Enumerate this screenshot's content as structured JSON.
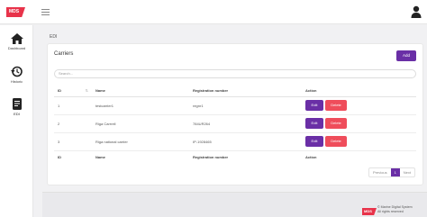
{
  "app": {
    "logo": "MDS",
    "breadcrumb": "EDI"
  },
  "sidebar": {
    "items": [
      {
        "label": "Dashboard",
        "icon": "home-icon"
      },
      {
        "label": "Historic",
        "icon": "history-icon"
      },
      {
        "label": "EDI",
        "icon": "document-icon"
      }
    ]
  },
  "card": {
    "title": "Carriers",
    "add_label": "Add",
    "search_placeholder": "Search..."
  },
  "table": {
    "headers": [
      "ID",
      "Name",
      "Registration number",
      "Action"
    ],
    "rows": [
      {
        "id": "1",
        "name": "testcarrier1",
        "reg": "regnr1"
      },
      {
        "id": "2",
        "name": "Riga Carrrell",
        "reg": "784UR264"
      },
      {
        "id": "3",
        "name": "Riga national carrier",
        "reg": "IP-1928465"
      }
    ],
    "edit_label": "Edit",
    "delete_label": "Delete"
  },
  "pagination": {
    "previous": "Previous",
    "current": "1",
    "next": "Next"
  },
  "footer": {
    "logo": "MDS",
    "line1": "© Marine Digital System",
    "line2": "All rights reserved"
  },
  "colors": {
    "brand": "#e8334a",
    "primary": "#6a2fa6",
    "danger": "#ef4d5b"
  }
}
